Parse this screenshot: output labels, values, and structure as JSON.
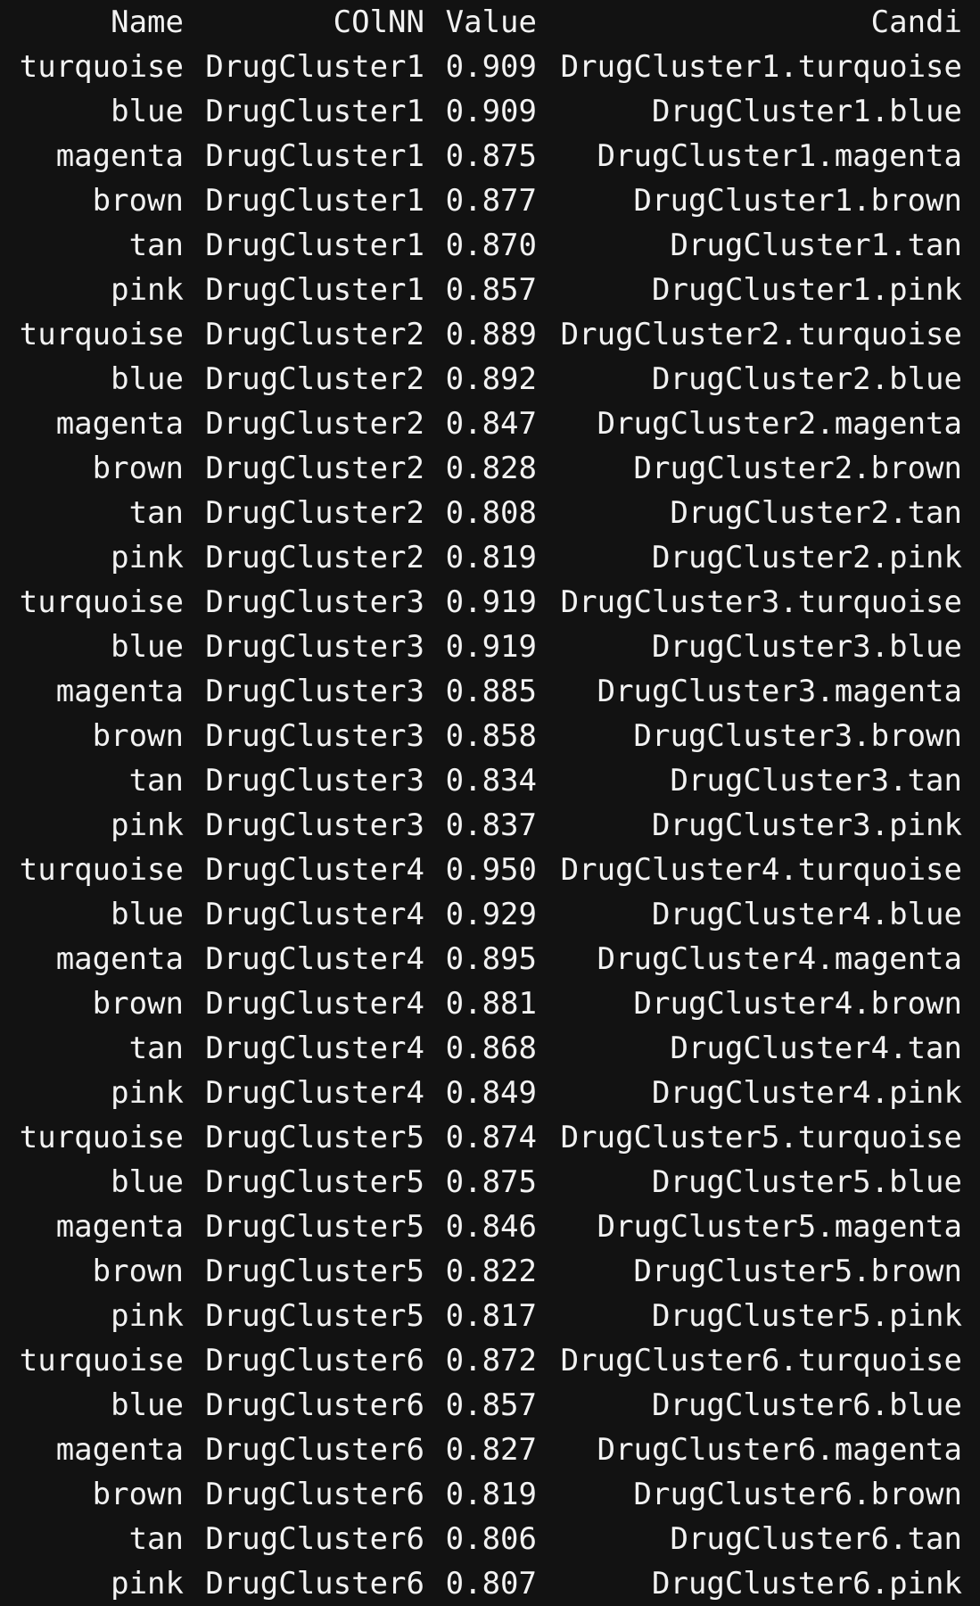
{
  "terminal": {
    "background": "#121212",
    "foreground": "#f2f2f2",
    "headers": {
      "name": "Name",
      "colnn": "COlNN",
      "value": "Value",
      "candi": "Candi"
    },
    "rows": [
      {
        "name": "turquoise",
        "colnn": "DrugCluster1",
        "value": "0.909",
        "candi": "DrugCluster1.turquoise"
      },
      {
        "name": "blue",
        "colnn": "DrugCluster1",
        "value": "0.909",
        "candi": "DrugCluster1.blue"
      },
      {
        "name": "magenta",
        "colnn": "DrugCluster1",
        "value": "0.875",
        "candi": "DrugCluster1.magenta"
      },
      {
        "name": "brown",
        "colnn": "DrugCluster1",
        "value": "0.877",
        "candi": "DrugCluster1.brown"
      },
      {
        "name": "tan",
        "colnn": "DrugCluster1",
        "value": "0.870",
        "candi": "DrugCluster1.tan"
      },
      {
        "name": "pink",
        "colnn": "DrugCluster1",
        "value": "0.857",
        "candi": "DrugCluster1.pink"
      },
      {
        "name": "turquoise",
        "colnn": "DrugCluster2",
        "value": "0.889",
        "candi": "DrugCluster2.turquoise"
      },
      {
        "name": "blue",
        "colnn": "DrugCluster2",
        "value": "0.892",
        "candi": "DrugCluster2.blue"
      },
      {
        "name": "magenta",
        "colnn": "DrugCluster2",
        "value": "0.847",
        "candi": "DrugCluster2.magenta"
      },
      {
        "name": "brown",
        "colnn": "DrugCluster2",
        "value": "0.828",
        "candi": "DrugCluster2.brown"
      },
      {
        "name": "tan",
        "colnn": "DrugCluster2",
        "value": "0.808",
        "candi": "DrugCluster2.tan"
      },
      {
        "name": "pink",
        "colnn": "DrugCluster2",
        "value": "0.819",
        "candi": "DrugCluster2.pink"
      },
      {
        "name": "turquoise",
        "colnn": "DrugCluster3",
        "value": "0.919",
        "candi": "DrugCluster3.turquoise"
      },
      {
        "name": "blue",
        "colnn": "DrugCluster3",
        "value": "0.919",
        "candi": "DrugCluster3.blue"
      },
      {
        "name": "magenta",
        "colnn": "DrugCluster3",
        "value": "0.885",
        "candi": "DrugCluster3.magenta"
      },
      {
        "name": "brown",
        "colnn": "DrugCluster3",
        "value": "0.858",
        "candi": "DrugCluster3.brown"
      },
      {
        "name": "tan",
        "colnn": "DrugCluster3",
        "value": "0.834",
        "candi": "DrugCluster3.tan"
      },
      {
        "name": "pink",
        "colnn": "DrugCluster3",
        "value": "0.837",
        "candi": "DrugCluster3.pink"
      },
      {
        "name": "turquoise",
        "colnn": "DrugCluster4",
        "value": "0.950",
        "candi": "DrugCluster4.turquoise"
      },
      {
        "name": "blue",
        "colnn": "DrugCluster4",
        "value": "0.929",
        "candi": "DrugCluster4.blue"
      },
      {
        "name": "magenta",
        "colnn": "DrugCluster4",
        "value": "0.895",
        "candi": "DrugCluster4.magenta"
      },
      {
        "name": "brown",
        "colnn": "DrugCluster4",
        "value": "0.881",
        "candi": "DrugCluster4.brown"
      },
      {
        "name": "tan",
        "colnn": "DrugCluster4",
        "value": "0.868",
        "candi": "DrugCluster4.tan"
      },
      {
        "name": "pink",
        "colnn": "DrugCluster4",
        "value": "0.849",
        "candi": "DrugCluster4.pink"
      },
      {
        "name": "turquoise",
        "colnn": "DrugCluster5",
        "value": "0.874",
        "candi": "DrugCluster5.turquoise"
      },
      {
        "name": "blue",
        "colnn": "DrugCluster5",
        "value": "0.875",
        "candi": "DrugCluster5.blue"
      },
      {
        "name": "magenta",
        "colnn": "DrugCluster5",
        "value": "0.846",
        "candi": "DrugCluster5.magenta"
      },
      {
        "name": "brown",
        "colnn": "DrugCluster5",
        "value": "0.822",
        "candi": "DrugCluster5.brown"
      },
      {
        "name": "pink",
        "colnn": "DrugCluster5",
        "value": "0.817",
        "candi": "DrugCluster5.pink"
      },
      {
        "name": "turquoise",
        "colnn": "DrugCluster6",
        "value": "0.872",
        "candi": "DrugCluster6.turquoise"
      },
      {
        "name": "blue",
        "colnn": "DrugCluster6",
        "value": "0.857",
        "candi": "DrugCluster6.blue"
      },
      {
        "name": "magenta",
        "colnn": "DrugCluster6",
        "value": "0.827",
        "candi": "DrugCluster6.magenta"
      },
      {
        "name": "brown",
        "colnn": "DrugCluster6",
        "value": "0.819",
        "candi": "DrugCluster6.brown"
      },
      {
        "name": "tan",
        "colnn": "DrugCluster6",
        "value": "0.806",
        "candi": "DrugCluster6.tan"
      },
      {
        "name": "pink",
        "colnn": "DrugCluster6",
        "value": "0.807",
        "candi": "DrugCluster6.pink"
      }
    ]
  }
}
